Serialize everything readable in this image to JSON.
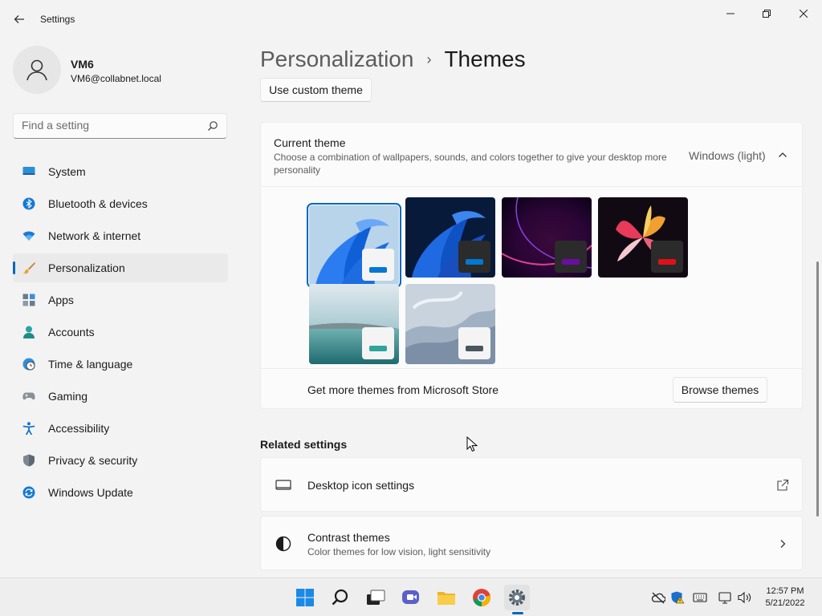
{
  "window": {
    "title": "Settings",
    "controls": {
      "minimize": "minimize-icon",
      "maximize": "restore-icon",
      "close": "close-icon"
    }
  },
  "profile": {
    "name": "VM6",
    "email": "VM6@collabnet.local"
  },
  "search": {
    "placeholder": "Find a setting"
  },
  "sidebar": {
    "items": [
      {
        "label": "System",
        "icon": "system-icon"
      },
      {
        "label": "Bluetooth & devices",
        "icon": "bluetooth-icon"
      },
      {
        "label": "Network & internet",
        "icon": "wifi-icon"
      },
      {
        "label": "Personalization",
        "icon": "brush-icon",
        "active": true
      },
      {
        "label": "Apps",
        "icon": "apps-icon"
      },
      {
        "label": "Accounts",
        "icon": "accounts-icon"
      },
      {
        "label": "Time & language",
        "icon": "clock-globe-icon"
      },
      {
        "label": "Gaming",
        "icon": "gamepad-icon"
      },
      {
        "label": "Accessibility",
        "icon": "accessibility-icon"
      },
      {
        "label": "Privacy & security",
        "icon": "shield-icon"
      },
      {
        "label": "Windows Update",
        "icon": "update-icon"
      }
    ]
  },
  "header": {
    "parent": "Personalization",
    "separator": "›",
    "current": "Themes"
  },
  "custom_theme_button": "Use custom theme",
  "current_theme": {
    "title": "Current theme",
    "description": "Choose a combination of wallpapers, sounds, and colors together to give your desktop more personality",
    "value": "Windows (light)",
    "themes": [
      {
        "name": "windows-light-bloom",
        "selected": true,
        "accent": "#0078d4"
      },
      {
        "name": "windows-dark-bloom",
        "accent": "#0078d4"
      },
      {
        "name": "glow",
        "accent": "#6b0da0"
      },
      {
        "name": "captured-motion",
        "accent": "#e0101a"
      },
      {
        "name": "sunrise",
        "accent": "#2ea59c"
      },
      {
        "name": "flow",
        "accent": "#4a5560"
      }
    ],
    "store_text": "Get more themes from Microsoft Store",
    "browse_button": "Browse themes"
  },
  "related": {
    "title": "Related settings",
    "items": [
      {
        "title": "Desktop icon settings",
        "icon": "desktop-icon",
        "end_icon": "external-link-icon"
      },
      {
        "title": "Contrast themes",
        "subtitle": "Color themes for low vision, light sensitivity",
        "icon": "contrast-icon",
        "end_icon": "chevron-right-icon"
      }
    ]
  },
  "taskbar": {
    "apps": [
      "start-icon",
      "search-icon",
      "task-view-icon",
      "chat-icon",
      "file-explorer-icon",
      "chrome-icon",
      "settings-icon"
    ],
    "tray": [
      "onedrive-icon",
      "defender-icon",
      "keyboard-icon",
      "network-icon",
      "volume-icon"
    ],
    "time": "12:57 PM",
    "date": "5/21/2022"
  },
  "colors": {
    "accent": "#0067c0",
    "background": "#f3f3f3",
    "card": "#fbfbfb"
  }
}
